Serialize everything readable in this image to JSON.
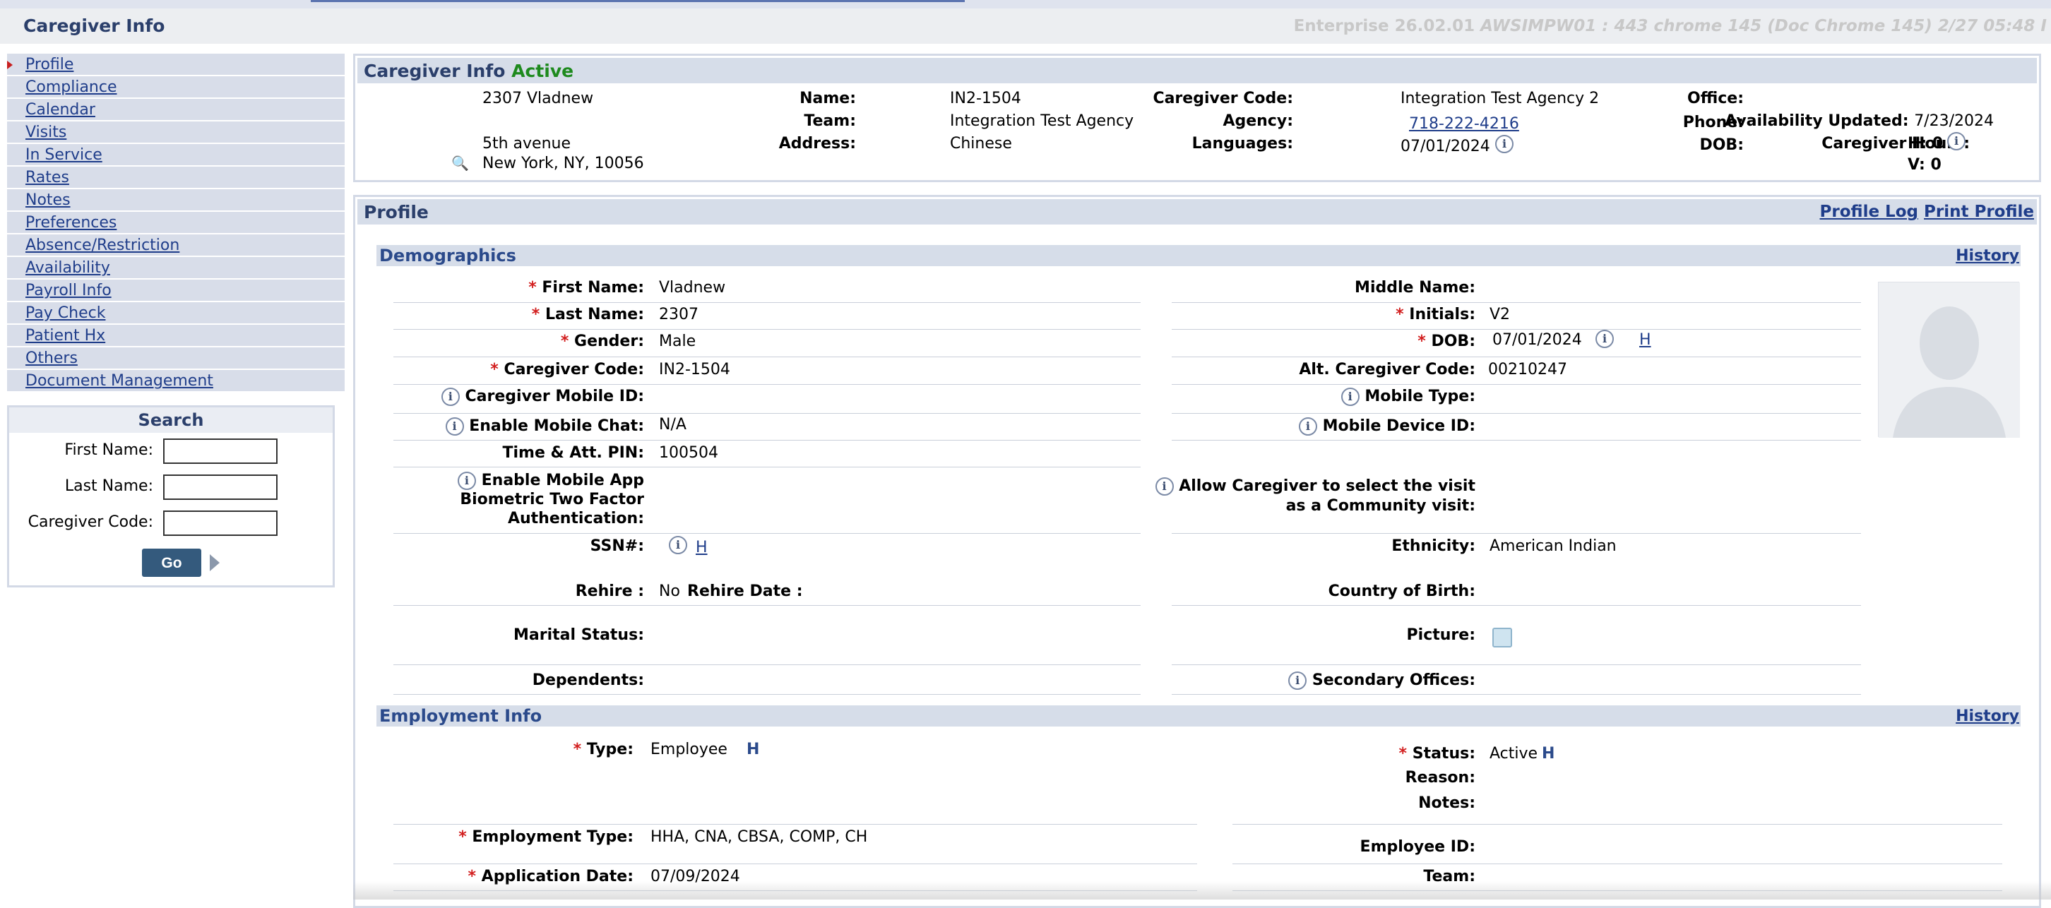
{
  "header": {
    "title": "Caregiver Info",
    "version_text": "Enterprise 26.02.01",
    "version_detail": "AWSIMPW01 : 443 chrome 145 (Doc Chrome 145) 2/27 05:48 I"
  },
  "nav": {
    "items": [
      {
        "label": "Profile"
      },
      {
        "label": "Compliance"
      },
      {
        "label": "Calendar"
      },
      {
        "label": "Visits"
      },
      {
        "label": "In Service"
      },
      {
        "label": "Rates"
      },
      {
        "label": "Notes"
      },
      {
        "label": "Preferences"
      },
      {
        "label": "Absence/Restriction"
      },
      {
        "label": "Availability"
      },
      {
        "label": "Payroll Info"
      },
      {
        "label": "Pay Check"
      },
      {
        "label": "Patient Hx"
      },
      {
        "label": "Others"
      },
      {
        "label": "Document Management"
      }
    ]
  },
  "search": {
    "title": "Search",
    "first_name_label": "First Name:",
    "last_name_label": "Last Name:",
    "code_label": "Caregiver Code:",
    "go_label": "Go",
    "first_name_value": "",
    "last_name_value": "",
    "code_value": ""
  },
  "info": {
    "title": "Caregiver Info",
    "status": "Active",
    "name_label": "Name:",
    "name": "2307 Vladnew",
    "team_label": "Team:",
    "team": "",
    "address_label": "Address:",
    "address1": "5th avenue",
    "address2": "New York, NY, 10056",
    "code_label": "Caregiver Code:",
    "code": "IN2-1504",
    "agency_label": "Agency:",
    "agency": "Integration Test Agency",
    "languages_label": "Languages:",
    "languages": "Chinese",
    "office_label": "Office:",
    "office": "Integration Test Agency 2",
    "phone_label": "Phone:",
    "phone": "718-222-4216",
    "dob_label": "DOB:",
    "dob": "07/01/2024",
    "avail_label": "Availability Updated:",
    "avail": "7/23/2024",
    "hours_label": "Caregiver Hours:",
    "hours_h": "H: 0",
    "hours_v": "V: 0"
  },
  "profile": {
    "title": "Profile",
    "log_link": "Profile Log",
    "print_link": "Print Profile",
    "demographics": {
      "title": "Demographics",
      "history": "History",
      "first_name_label": "First Name:",
      "first_name": "Vladnew",
      "last_name_label": "Last Name:",
      "last_name": "2307",
      "gender_label": "Gender:",
      "gender": "Male",
      "code_label": "Caregiver Code:",
      "code": "IN2-1504",
      "mobile_id_label": "Caregiver Mobile ID:",
      "mobile_chat_label": "Enable Mobile Chat:",
      "mobile_chat": "N/A",
      "pin_label": "Time & Att. PIN:",
      "pin": "100504",
      "biometric_label_1": "Enable Mobile App",
      "biometric_label_2": "Biometric Two Factor",
      "biometric_label_3": "Authentication:",
      "ssn_label": "SSN#:",
      "ssn_h": "H",
      "rehire_label": "Rehire :",
      "rehire": "No",
      "rehire_date_label": "Rehire Date :",
      "marital_label": "Marital Status:",
      "dependents_label": "Dependents:",
      "middle_name_label": "Middle Name:",
      "initials_label": "Initials:",
      "initials": "V2",
      "dob_label": "DOB:",
      "dob": "07/01/2024",
      "dob_h": "H",
      "alt_code_label": "Alt. Caregiver Code:",
      "alt_code": "00210247",
      "mobile_type_label": "Mobile Type:",
      "mobile_device_label": "Mobile Device ID:",
      "community_label_1": "Allow Caregiver to select the visit",
      "community_label_2": "as a Community visit:",
      "ethnicity_label": "Ethnicity:",
      "ethnicity": "American Indian",
      "country_label": "Country of Birth:",
      "picture_label": "Picture:",
      "secondary_label": "Secondary Offices:"
    },
    "employment": {
      "title": "Employment Info",
      "history": "History",
      "type_label": "Type:",
      "type": "Employee",
      "type_h": "H",
      "status_label": "Status:",
      "status": "Active",
      "status_h": "H",
      "reason_label": "Reason:",
      "notes_label": "Notes:",
      "emp_type_label": "Employment Type:",
      "emp_type": "HHA, CNA, CBSA, COMP, CH",
      "employee_id_label": "Employee ID:",
      "app_date_label": "Application Date:",
      "app_date": "07/09/2024",
      "team_label": "Team:"
    }
  },
  "colors": {
    "accent": "#2b3f6b",
    "link": "#1f3d8a",
    "active": "#1e8a1e",
    "required": "#d21e1e",
    "section_bg": "#d6dde9"
  }
}
